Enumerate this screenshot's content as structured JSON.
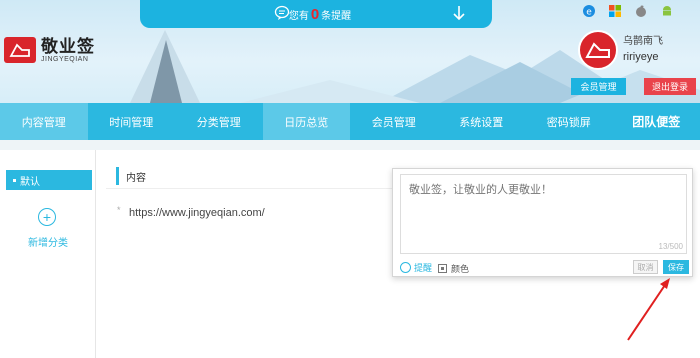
{
  "notice": {
    "prefix": "您有",
    "count": "0",
    "suffix": "条提醒",
    "icons": [
      "message-bubble-icon",
      "arrow-down-icon"
    ]
  },
  "logo": {
    "name_cn": "敬业签",
    "name_en": "JINGYEQIAN"
  },
  "platforms": [
    "ie-icon",
    "windows-icon",
    "apple-icon",
    "android-icon"
  ],
  "user": {
    "name_cn": "乌鹊南飞",
    "name_en": "ririyeye"
  },
  "header_buttons": {
    "member": "会员管理",
    "logout": "退出登录"
  },
  "nav": [
    {
      "label": "内容管理",
      "active": true
    },
    {
      "label": "时间管理"
    },
    {
      "label": "分类管理"
    },
    {
      "label": "日历总览",
      "active": true
    },
    {
      "label": "会员管理"
    },
    {
      "label": "系统设置"
    },
    {
      "label": "密码锁屏"
    },
    {
      "label": "团队便签",
      "bold": true
    }
  ],
  "sidebar": {
    "default_label": "默认",
    "add_label": "新增分类"
  },
  "content": {
    "header": "内容",
    "items": [
      "https://www.jingyeqian.com/"
    ]
  },
  "editor": {
    "placeholder": "敬业签，让敬业的人更敬业！",
    "counter": "13/500",
    "remind_label": "提醒",
    "color_label": "颜色",
    "cancel_label": "取消",
    "save_label": "保存"
  },
  "colors": {
    "accent": "#2bb8e0",
    "brand_red": "#d9252b",
    "logout_red": "#e9434b"
  }
}
